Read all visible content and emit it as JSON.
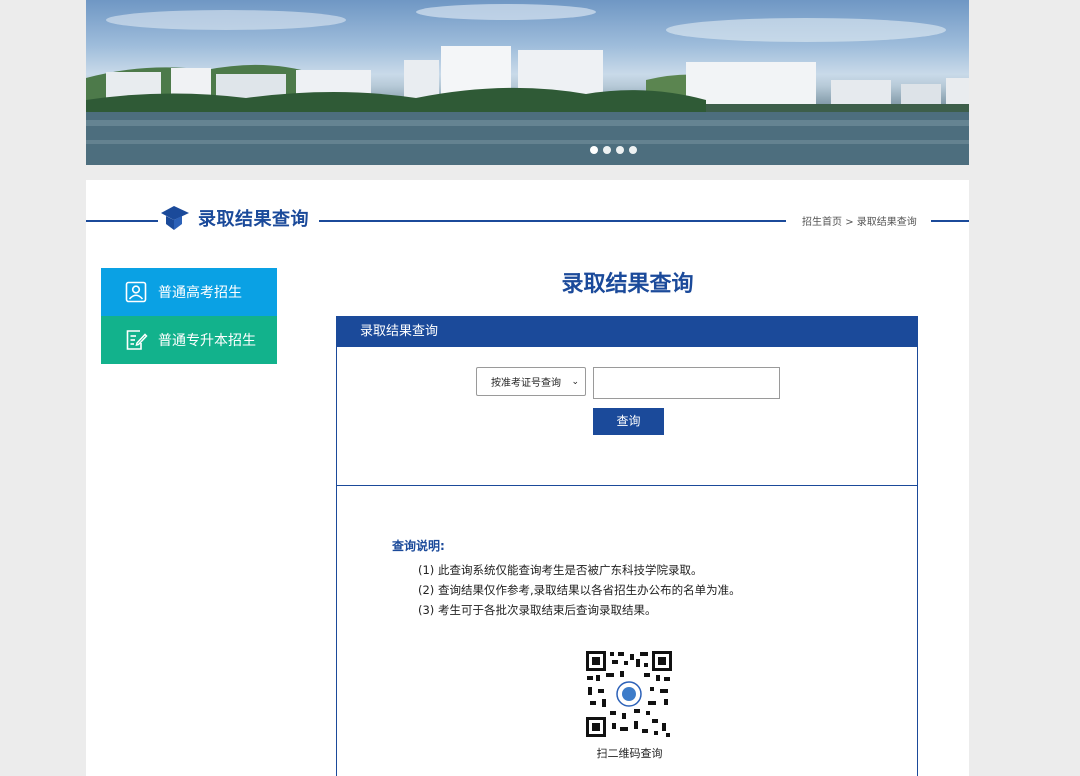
{
  "banner": {
    "slide_count": 4,
    "active_slide": 1
  },
  "section": {
    "title": "录取结果查询"
  },
  "breadcrumb": {
    "home": "招生首页",
    "separator": ">",
    "current": "录取结果查询"
  },
  "sidebar": {
    "items": [
      {
        "label": "普通高考招生",
        "icon": "user-card-icon",
        "color": "#0aa1e4"
      },
      {
        "label": "普通专升本招生",
        "icon": "edit-note-icon",
        "color": "#12b28c"
      }
    ]
  },
  "main": {
    "heading": "录取结果查询",
    "box_title": "录取结果查询",
    "query_type": "按准考证号查询",
    "query_value": "",
    "submit_label": "查询",
    "notes_title": "查询说明:",
    "notes": [
      "(1) 此查询系统仅能查询考生是否被广东科技学院录取。",
      "(2) 查询结果仅作参考,录取结果以各省招生办公布的名单为准。",
      "(3) 考生可于各批次录取结束后查询录取结果。"
    ],
    "qr_label": "扫二维码查询"
  },
  "colors": {
    "primary": "#1b4a9a",
    "sidebar_blue": "#0aa1e4",
    "sidebar_green": "#12b28c"
  }
}
